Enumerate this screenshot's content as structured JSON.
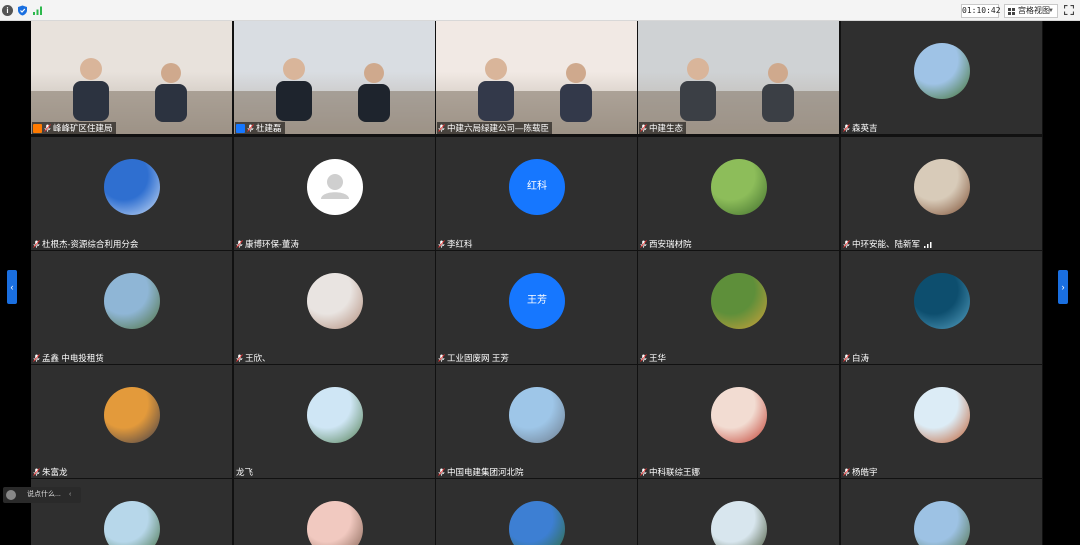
{
  "topbar": {
    "timer": "01:10:42",
    "view_label": "宫格视图",
    "icons": [
      "info-icon",
      "shield-icon",
      "signal-icon",
      "grid-icon",
      "chevron-down-icon",
      "fullscreen-icon"
    ]
  },
  "chat": {
    "placeholder": "说点什么..."
  },
  "colors": {
    "accent": "#1677ff",
    "tile_bg": "#2f2f2f",
    "host_badge": "#ff7a00"
  },
  "tiles": [
    {
      "name": "峰峰矿区住建局",
      "kind": "video",
      "badge": "host"
    },
    {
      "name": "杜建磊",
      "kind": "video",
      "badge": "cohost"
    },
    {
      "name": "中建六局绿建公司—陈载臣",
      "kind": "video"
    },
    {
      "name": "中建生态",
      "kind": "video"
    },
    {
      "name": "森英吉",
      "kind": "photo"
    },
    {
      "name": "杜根杰-资源综合利用分会",
      "kind": "photo"
    },
    {
      "name": "康博环保-董涛",
      "kind": "default"
    },
    {
      "name": "李红科",
      "kind": "text",
      "avatar_text": "红科"
    },
    {
      "name": "西安瑞材院",
      "kind": "photo"
    },
    {
      "name": "中环安能、陆新军",
      "kind": "photo",
      "signal": true
    },
    {
      "name": "孟鑫 中电投租赁",
      "kind": "photo"
    },
    {
      "name": "王欣、",
      "kind": "photo"
    },
    {
      "name": "工业固废网 王芳",
      "kind": "text",
      "avatar_text": "王芳"
    },
    {
      "name": "王华",
      "kind": "photo"
    },
    {
      "name": "白涛",
      "kind": "photo"
    },
    {
      "name": "朱富龙",
      "kind": "photo"
    },
    {
      "name": "龙飞",
      "kind": "photo",
      "nomic": true
    },
    {
      "name": "中国电建集团河北院",
      "kind": "photo"
    },
    {
      "name": "中科联综王娜",
      "kind": "photo"
    },
    {
      "name": "杨皓宇",
      "kind": "photo"
    },
    {
      "name": "",
      "kind": "photo"
    },
    {
      "name": "",
      "kind": "photo"
    },
    {
      "name": "",
      "kind": "photo"
    },
    {
      "name": "",
      "kind": "photo"
    },
    {
      "name": "",
      "kind": "photo"
    }
  ]
}
